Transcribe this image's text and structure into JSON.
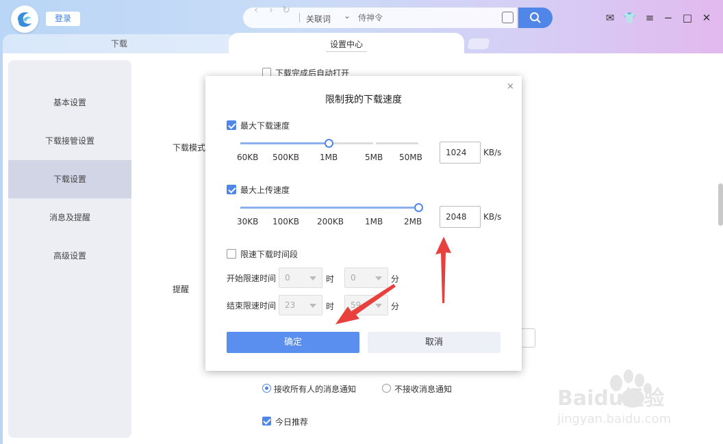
{
  "header": {
    "login_label": "登录",
    "search_mode": "关联词",
    "search_placeholder": "侍神令"
  },
  "tabs": [
    {
      "label": "下载"
    },
    {
      "label": "设置中心"
    }
  ],
  "sidebar": {
    "items": [
      {
        "label": "基本设置"
      },
      {
        "label": "下载接管设置"
      },
      {
        "label": "下载设置"
      },
      {
        "label": "消息及提醒"
      },
      {
        "label": "高级设置"
      }
    ]
  },
  "settings_bg": {
    "auto_open_label": "下载完成后自动打开",
    "download_mode_label": "下载模式",
    "reminder_label": "提醒",
    "notify_all_label": "接收所有人的消息通知",
    "no_notify_label": "不接收消息通知",
    "today_recommend_label": "今日推荐"
  },
  "dialog": {
    "title": "限制我的下载速度",
    "close": "×",
    "max_download": {
      "label": "最大下载速度",
      "checked": true,
      "ticks": [
        "60KB",
        "500KB",
        "1MB",
        "5MB",
        "50MB"
      ],
      "value": "1024",
      "unit": "KB/s",
      "slider_position": 0.5
    },
    "max_upload": {
      "label": "最大上传速度",
      "checked": true,
      "ticks": [
        "30KB",
        "100KB",
        "200KB",
        "1MB",
        "2MB"
      ],
      "value": "2048",
      "unit": "KB/s",
      "slider_position": 1.0
    },
    "time_limit": {
      "label": "限速下载时间段",
      "checked": false,
      "start_label": "开始限速时间",
      "end_label": "结束限速时间",
      "start_hour": "0",
      "start_minute": "0",
      "end_hour": "23",
      "end_minute": "59",
      "hour_unit": "时",
      "minute_unit": "分"
    },
    "ok_label": "确定",
    "cancel_label": "取消"
  },
  "colors": {
    "accent": "#4f86e8",
    "annotation_arrow": "#e8403c"
  },
  "watermark": {
    "brand": "Baidu经验",
    "url": "jingyan.baidu.com"
  }
}
